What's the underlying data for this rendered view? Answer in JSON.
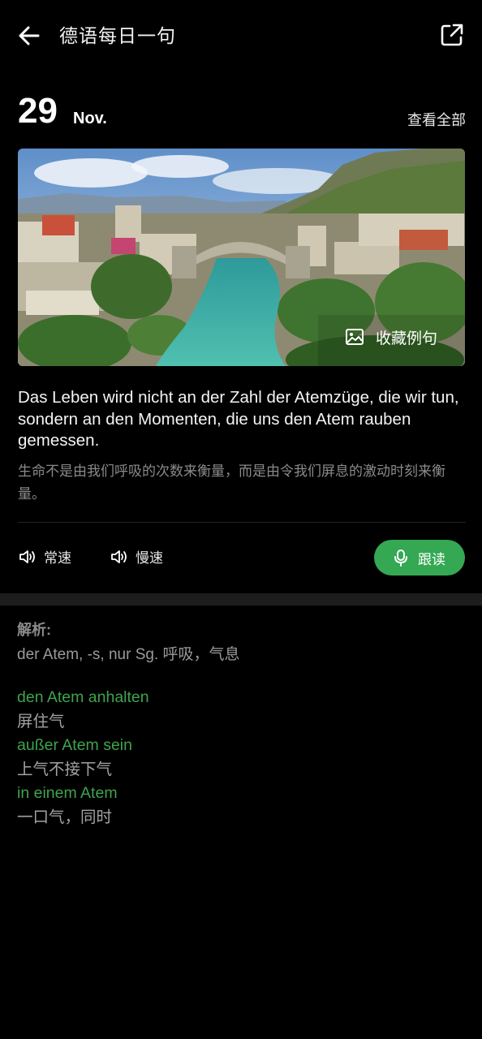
{
  "header": {
    "title": "德语每日一句"
  },
  "date": {
    "day": "29",
    "month": "Nov.",
    "view_all": "查看全部"
  },
  "image": {
    "collect_label": "收藏例句"
  },
  "sentence": {
    "german": "Das Leben wird nicht an der Zahl der Atemzüge, die wir tun, sondern an den Momenten, die uns den Atem rauben gemessen.",
    "chinese": "生命不是由我们呼吸的次数来衡量，而是由令我们屏息的激动时刻来衡量。"
  },
  "audio": {
    "normal_label": "常速",
    "slow_label": "慢速",
    "read_label": "跟读",
    "accent_color": "#34a853"
  },
  "analysis": {
    "label": "解析:",
    "definition": "der Atem, -s, nur Sg. 呼吸，气息",
    "phrases": [
      {
        "de": "den Atem anhalten",
        "zh": "屏住气"
      },
      {
        "de": "außer Atem sein",
        "zh": "上气不接下气"
      },
      {
        "de": "in einem Atem",
        "zh": "一口气，同时"
      }
    ]
  },
  "colors": {
    "background": "#000000",
    "phrase_green": "#3fa34d",
    "separator": "#1d1d1d"
  }
}
